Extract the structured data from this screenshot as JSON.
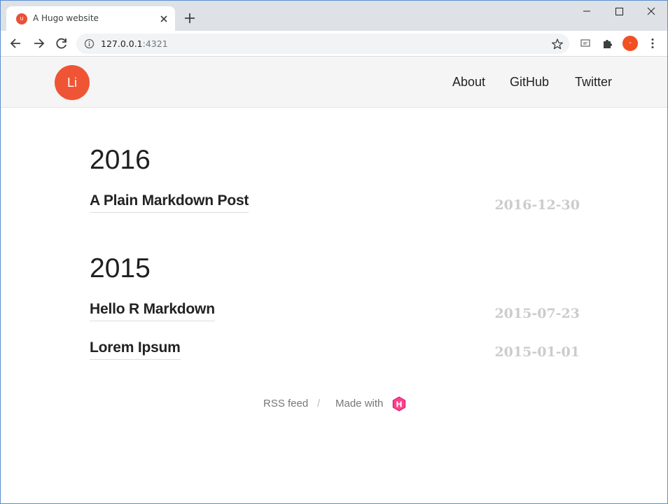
{
  "browser": {
    "tab_title": "A Hugo website",
    "tab_favicon_letter": "U",
    "url_host": "127.0.0.1",
    "url_port": ":4321",
    "profile_initial": "-",
    "accent_color": "#e8503a"
  },
  "site": {
    "logo_text": "Li",
    "nav": [
      {
        "label": "About"
      },
      {
        "label": "GitHub"
      },
      {
        "label": "Twitter"
      }
    ]
  },
  "archive": [
    {
      "year": "2016",
      "posts": [
        {
          "title": "A Plain Markdown Post",
          "date": "2016-12-30"
        }
      ]
    },
    {
      "year": "2015",
      "posts": [
        {
          "title": "Hello R Markdown",
          "date": "2015-07-23"
        },
        {
          "title": "Lorem Ipsum",
          "date": "2015-01-01"
        }
      ]
    }
  ],
  "footer": {
    "rss_label": "RSS feed",
    "separator": "/",
    "made_with_label": "Made with",
    "hugo_icon_letter": "H",
    "hugo_icon_color": "#ff4088"
  }
}
